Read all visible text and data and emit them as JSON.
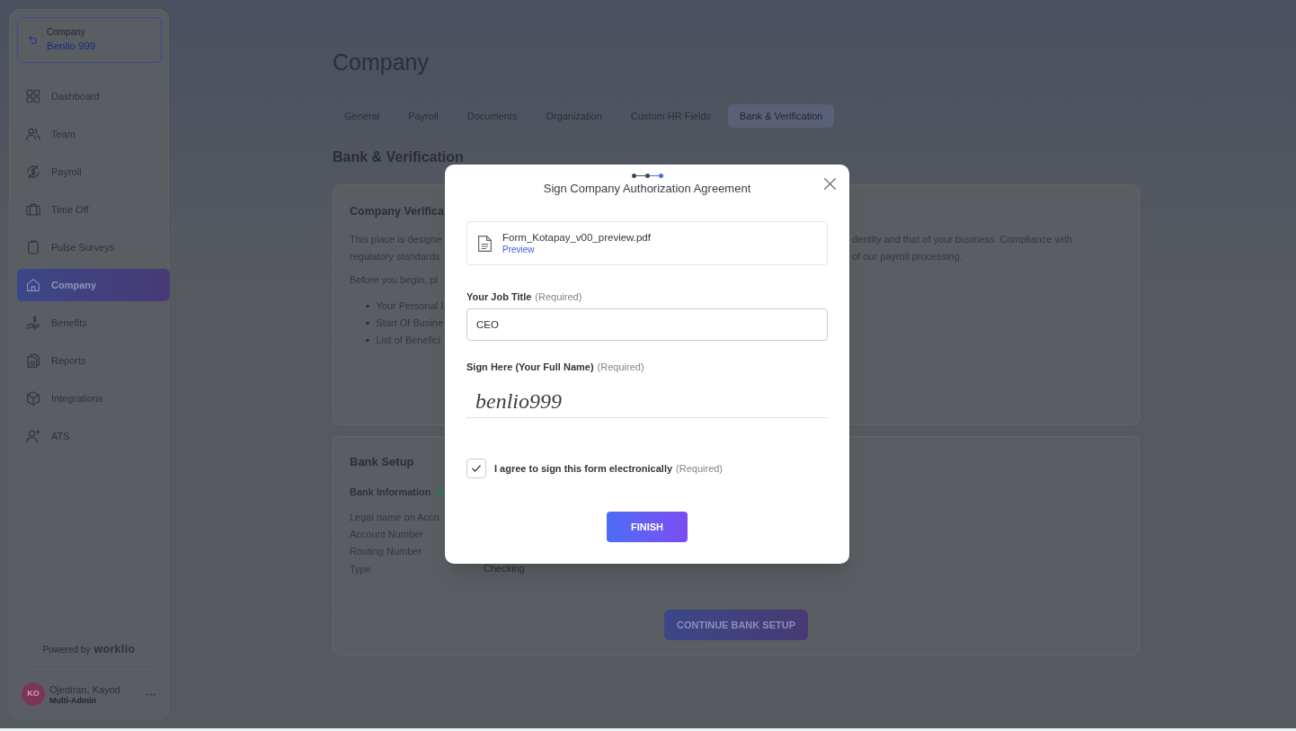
{
  "sidebar": {
    "company_switcher": {
      "label": "Company",
      "value": "Benlio 999"
    },
    "items": [
      {
        "label": "Dashboard",
        "selected": false
      },
      {
        "label": "Team",
        "selected": false
      },
      {
        "label": "Payroll",
        "selected": false
      },
      {
        "label": "Time Off",
        "selected": false
      },
      {
        "label": "Pulse Surveys",
        "selected": false
      },
      {
        "label": "Company",
        "selected": true
      },
      {
        "label": "Benefits",
        "selected": false
      },
      {
        "label": "Reports",
        "selected": false
      },
      {
        "label": "Integrations",
        "selected": false
      },
      {
        "label": "ATS",
        "selected": false
      }
    ],
    "powered_by": {
      "text": "Powered by",
      "brand": "worklio"
    },
    "user": {
      "initials": "KO",
      "name": "Ojediran, Kayod",
      "role": "Multi-Admin"
    }
  },
  "page": {
    "title": "Company",
    "tabs": [
      {
        "label": "General",
        "selected": false
      },
      {
        "label": "Payroll",
        "selected": false
      },
      {
        "label": "Documents",
        "selected": false
      },
      {
        "label": "Organization",
        "selected": false
      },
      {
        "label": "Custom HR Fields",
        "selected": false
      },
      {
        "label": "Bank & Verification",
        "selected": true
      }
    ],
    "section_title": "Bank & Verification"
  },
  "verification_card": {
    "title": "Company Verifica",
    "paragraph": [
      {
        "left": "This place is designe",
        "right": "dentity and that of your business. Compliance with"
      },
      {
        "left": "regulatory standards",
        "right": "of our payroll processing."
      }
    ],
    "intro": "Before you begin, pl",
    "bullets": [
      "Your Personal I",
      "Start Of Busine",
      "List of Benefici"
    ]
  },
  "bank_card": {
    "title": "Bank Setup",
    "subtitle": "Bank Information",
    "rows": [
      {
        "label": "Legal name on Acco"
      },
      {
        "label": "Account Number"
      },
      {
        "label": "Routing Number"
      },
      {
        "label": "Type",
        "value": "Checking"
      }
    ],
    "button": "CONTINUE BANK SETUP"
  },
  "modal": {
    "steps": [
      {
        "selected": false
      },
      {
        "selected": false
      },
      {
        "selected": true
      }
    ],
    "title": "Sign Company Authorization Agreement",
    "file": {
      "name": "Form_Kotapay_v00_preview.pdf",
      "link": "Preview"
    },
    "job_title": {
      "label": "Your Job Title",
      "note": "(Required)",
      "value": "CEO"
    },
    "signature": {
      "label": "Sign Here (Your Full Name)",
      "note": "(Required)",
      "value": "benlio999"
    },
    "agreement": {
      "label": "I agree to sign this form electronically",
      "note": "(Required)",
      "checked": true
    },
    "button": "FINISH"
  }
}
